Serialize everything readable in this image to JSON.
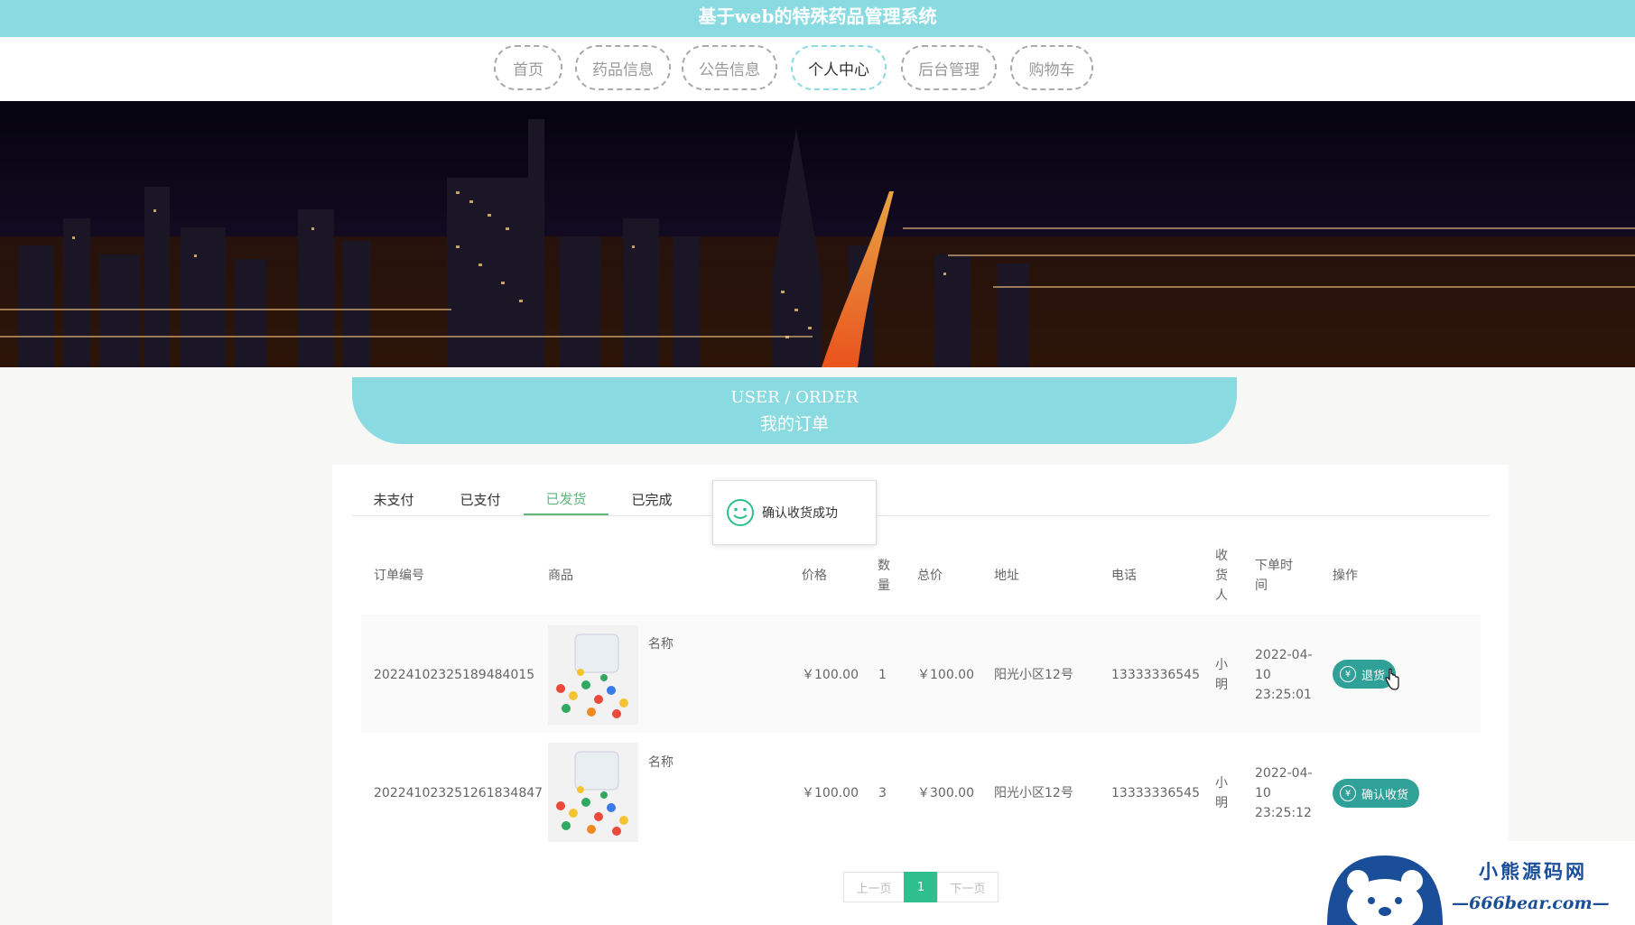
{
  "site": {
    "title": "基于web的特殊药品管理系统"
  },
  "nav": {
    "items": [
      {
        "label": "首页"
      },
      {
        "label": "药品信息"
      },
      {
        "label": "公告信息"
      },
      {
        "label": "个人中心"
      },
      {
        "label": "后台管理"
      },
      {
        "label": "购物车"
      }
    ],
    "active_index": 3
  },
  "section": {
    "title_en": "USER / ORDER",
    "title_cn": "我的订单"
  },
  "tabs": {
    "items": [
      {
        "label": "未支付"
      },
      {
        "label": "已支付"
      },
      {
        "label": "已发货"
      },
      {
        "label": "已完成"
      }
    ],
    "active_index": 2
  },
  "toast": {
    "message": "确认收货成功",
    "icon": "smile-icon"
  },
  "table": {
    "headers": {
      "order_no": "订单编号",
      "product": "商品",
      "price": "价格",
      "qty": "数量",
      "total": "总价",
      "address": "地址",
      "phone": "电话",
      "receiver": "收货人",
      "order_time": "下单时间",
      "action": "操作"
    },
    "rows": [
      {
        "order_no": "20224102325189484015",
        "product_name": "名称",
        "price": "￥100.00",
        "qty": "1",
        "total": "￥100.00",
        "address": "阳光小区12号",
        "phone": "13333336545",
        "receiver": "小明",
        "order_time": "2022-04-10 23:25:01",
        "action_label": "退货"
      },
      {
        "order_no": "20224102325126183484​7",
        "product_name": "名称",
        "price": "￥100.00",
        "qty": "3",
        "total": "￥300.00",
        "address": "阳光小区12号",
        "phone": "13333336545",
        "receiver": "小明",
        "order_time": "2022-04-10 23:25:12",
        "action_label": "确认收货"
      }
    ]
  },
  "pagination": {
    "prev": "上一页",
    "current": "1",
    "next": "下一页"
  },
  "watermark": {
    "title": "小熊源码网",
    "url": "—666bear.com—"
  },
  "colors": {
    "accent": "#8adbe1",
    "button": "#2fa198",
    "tab_active": "#5fb878",
    "page_current": "#2fbf8e"
  }
}
